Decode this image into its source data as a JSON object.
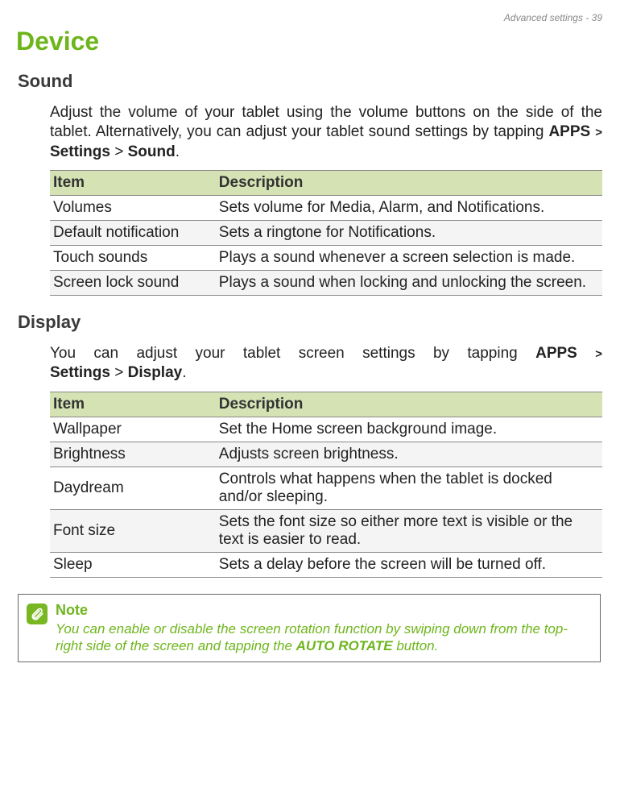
{
  "running_header": "Advanced settings - 39",
  "h1": "Device",
  "sound": {
    "heading": "Sound",
    "intro_pre": "Adjust the volume of your tablet using the volume buttons on the side of the tablet. Alternatively, you can adjust your tablet sound settings by tapping ",
    "nav_apps": "APPS",
    "gt1": ">",
    "nav_settings": "Settings",
    "gt2": ">",
    "nav_sound": "Sound",
    "period": ".",
    "header_item": "Item",
    "header_desc": "Description",
    "rows": [
      {
        "item": "Volumes",
        "desc": "Sets volume for Media, Alarm, and Notifications."
      },
      {
        "item": "Default notification",
        "desc": "Sets a ringtone for Notifications."
      },
      {
        "item": "Touch sounds",
        "desc": "Plays a sound whenever a screen selection is made."
      },
      {
        "item": "Screen lock sound",
        "desc": "Plays a sound when locking and unlocking the screen."
      }
    ]
  },
  "display": {
    "heading": "Display",
    "intro_pre": "You can adjust your tablet screen settings by tapping ",
    "nav_apps": "APPS",
    "gt1": ">",
    "nav_settings": "Settings",
    "gt2": ">",
    "nav_display": "Display",
    "period": ".",
    "header_item": "Item",
    "header_desc": "Description",
    "rows": [
      {
        "item": "Wallpaper",
        "desc": "Set the Home screen background image."
      },
      {
        "item": "Brightness",
        "desc": "Adjusts screen brightness."
      },
      {
        "item": "Daydream",
        "desc": "Controls what happens when the tablet is docked and/or sleeping."
      },
      {
        "item": "Font size",
        "desc": "Sets the font size so either more text is visible or the text is easier to read."
      },
      {
        "item": "Sleep",
        "desc": "Sets a delay before the screen will be turned off."
      }
    ]
  },
  "note": {
    "title": "Note",
    "text_pre": "You can enable or disable the screen rotation function by swiping down from the top-right side of the screen and tapping the ",
    "text_bold": "AUTO ROTATE",
    "text_post": " button."
  }
}
